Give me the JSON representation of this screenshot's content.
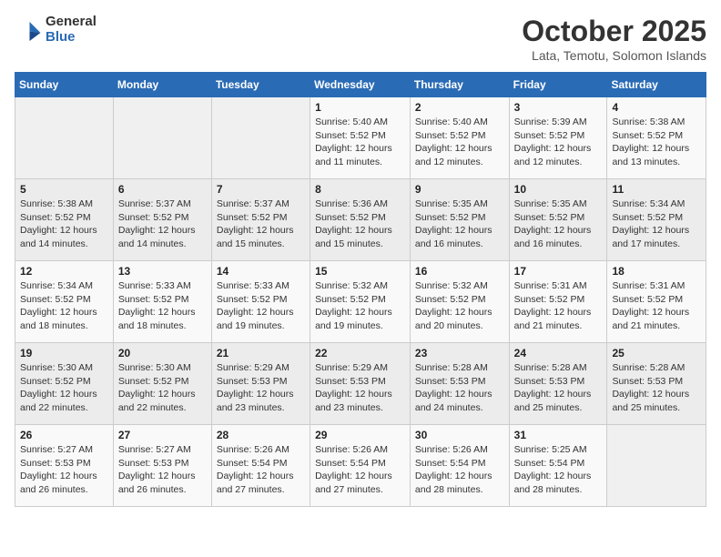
{
  "logo": {
    "general": "General",
    "blue": "Blue"
  },
  "title": "October 2025",
  "location": "Lata, Temotu, Solomon Islands",
  "weekdays": [
    "Sunday",
    "Monday",
    "Tuesday",
    "Wednesday",
    "Thursday",
    "Friday",
    "Saturday"
  ],
  "weeks": [
    [
      {
        "day": "",
        "sunrise": "",
        "sunset": "",
        "daylight": ""
      },
      {
        "day": "",
        "sunrise": "",
        "sunset": "",
        "daylight": ""
      },
      {
        "day": "",
        "sunrise": "",
        "sunset": "",
        "daylight": ""
      },
      {
        "day": "1",
        "sunrise": "Sunrise: 5:40 AM",
        "sunset": "Sunset: 5:52 PM",
        "daylight": "Daylight: 12 hours and 11 minutes."
      },
      {
        "day": "2",
        "sunrise": "Sunrise: 5:40 AM",
        "sunset": "Sunset: 5:52 PM",
        "daylight": "Daylight: 12 hours and 12 minutes."
      },
      {
        "day": "3",
        "sunrise": "Sunrise: 5:39 AM",
        "sunset": "Sunset: 5:52 PM",
        "daylight": "Daylight: 12 hours and 12 minutes."
      },
      {
        "day": "4",
        "sunrise": "Sunrise: 5:38 AM",
        "sunset": "Sunset: 5:52 PM",
        "daylight": "Daylight: 12 hours and 13 minutes."
      }
    ],
    [
      {
        "day": "5",
        "sunrise": "Sunrise: 5:38 AM",
        "sunset": "Sunset: 5:52 PM",
        "daylight": "Daylight: 12 hours and 14 minutes."
      },
      {
        "day": "6",
        "sunrise": "Sunrise: 5:37 AM",
        "sunset": "Sunset: 5:52 PM",
        "daylight": "Daylight: 12 hours and 14 minutes."
      },
      {
        "day": "7",
        "sunrise": "Sunrise: 5:37 AM",
        "sunset": "Sunset: 5:52 PM",
        "daylight": "Daylight: 12 hours and 15 minutes."
      },
      {
        "day": "8",
        "sunrise": "Sunrise: 5:36 AM",
        "sunset": "Sunset: 5:52 PM",
        "daylight": "Daylight: 12 hours and 15 minutes."
      },
      {
        "day": "9",
        "sunrise": "Sunrise: 5:35 AM",
        "sunset": "Sunset: 5:52 PM",
        "daylight": "Daylight: 12 hours and 16 minutes."
      },
      {
        "day": "10",
        "sunrise": "Sunrise: 5:35 AM",
        "sunset": "Sunset: 5:52 PM",
        "daylight": "Daylight: 12 hours and 16 minutes."
      },
      {
        "day": "11",
        "sunrise": "Sunrise: 5:34 AM",
        "sunset": "Sunset: 5:52 PM",
        "daylight": "Daylight: 12 hours and 17 minutes."
      }
    ],
    [
      {
        "day": "12",
        "sunrise": "Sunrise: 5:34 AM",
        "sunset": "Sunset: 5:52 PM",
        "daylight": "Daylight: 12 hours and 18 minutes."
      },
      {
        "day": "13",
        "sunrise": "Sunrise: 5:33 AM",
        "sunset": "Sunset: 5:52 PM",
        "daylight": "Daylight: 12 hours and 18 minutes."
      },
      {
        "day": "14",
        "sunrise": "Sunrise: 5:33 AM",
        "sunset": "Sunset: 5:52 PM",
        "daylight": "Daylight: 12 hours and 19 minutes."
      },
      {
        "day": "15",
        "sunrise": "Sunrise: 5:32 AM",
        "sunset": "Sunset: 5:52 PM",
        "daylight": "Daylight: 12 hours and 19 minutes."
      },
      {
        "day": "16",
        "sunrise": "Sunrise: 5:32 AM",
        "sunset": "Sunset: 5:52 PM",
        "daylight": "Daylight: 12 hours and 20 minutes."
      },
      {
        "day": "17",
        "sunrise": "Sunrise: 5:31 AM",
        "sunset": "Sunset: 5:52 PM",
        "daylight": "Daylight: 12 hours and 21 minutes."
      },
      {
        "day": "18",
        "sunrise": "Sunrise: 5:31 AM",
        "sunset": "Sunset: 5:52 PM",
        "daylight": "Daylight: 12 hours and 21 minutes."
      }
    ],
    [
      {
        "day": "19",
        "sunrise": "Sunrise: 5:30 AM",
        "sunset": "Sunset: 5:52 PM",
        "daylight": "Daylight: 12 hours and 22 minutes."
      },
      {
        "day": "20",
        "sunrise": "Sunrise: 5:30 AM",
        "sunset": "Sunset: 5:52 PM",
        "daylight": "Daylight: 12 hours and 22 minutes."
      },
      {
        "day": "21",
        "sunrise": "Sunrise: 5:29 AM",
        "sunset": "Sunset: 5:53 PM",
        "daylight": "Daylight: 12 hours and 23 minutes."
      },
      {
        "day": "22",
        "sunrise": "Sunrise: 5:29 AM",
        "sunset": "Sunset: 5:53 PM",
        "daylight": "Daylight: 12 hours and 23 minutes."
      },
      {
        "day": "23",
        "sunrise": "Sunrise: 5:28 AM",
        "sunset": "Sunset: 5:53 PM",
        "daylight": "Daylight: 12 hours and 24 minutes."
      },
      {
        "day": "24",
        "sunrise": "Sunrise: 5:28 AM",
        "sunset": "Sunset: 5:53 PM",
        "daylight": "Daylight: 12 hours and 25 minutes."
      },
      {
        "day": "25",
        "sunrise": "Sunrise: 5:28 AM",
        "sunset": "Sunset: 5:53 PM",
        "daylight": "Daylight: 12 hours and 25 minutes."
      }
    ],
    [
      {
        "day": "26",
        "sunrise": "Sunrise: 5:27 AM",
        "sunset": "Sunset: 5:53 PM",
        "daylight": "Daylight: 12 hours and 26 minutes."
      },
      {
        "day": "27",
        "sunrise": "Sunrise: 5:27 AM",
        "sunset": "Sunset: 5:53 PM",
        "daylight": "Daylight: 12 hours and 26 minutes."
      },
      {
        "day": "28",
        "sunrise": "Sunrise: 5:26 AM",
        "sunset": "Sunset: 5:54 PM",
        "daylight": "Daylight: 12 hours and 27 minutes."
      },
      {
        "day": "29",
        "sunrise": "Sunrise: 5:26 AM",
        "sunset": "Sunset: 5:54 PM",
        "daylight": "Daylight: 12 hours and 27 minutes."
      },
      {
        "day": "30",
        "sunrise": "Sunrise: 5:26 AM",
        "sunset": "Sunset: 5:54 PM",
        "daylight": "Daylight: 12 hours and 28 minutes."
      },
      {
        "day": "31",
        "sunrise": "Sunrise: 5:25 AM",
        "sunset": "Sunset: 5:54 PM",
        "daylight": "Daylight: 12 hours and 28 minutes."
      },
      {
        "day": "",
        "sunrise": "",
        "sunset": "",
        "daylight": ""
      }
    ]
  ]
}
